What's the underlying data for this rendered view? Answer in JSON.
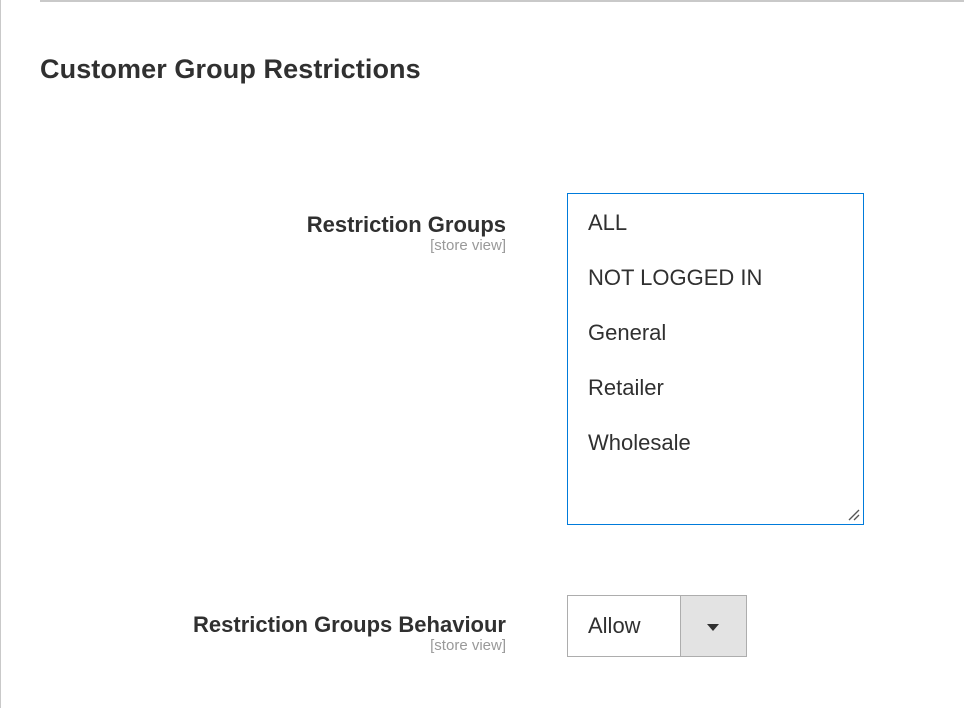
{
  "section": {
    "title": "Customer Group Restrictions"
  },
  "restriction_groups": {
    "label": "Restriction Groups",
    "scope": "[store view]",
    "options": [
      "ALL",
      "NOT LOGGED IN",
      "General",
      "Retailer",
      "Wholesale"
    ]
  },
  "restriction_groups_behaviour": {
    "label": "Restriction Groups Behaviour",
    "scope": "[store view]",
    "selected": "Allow"
  },
  "colors": {
    "focus_border": "#007bdb",
    "text": "#303030",
    "scope_text": "#999999",
    "select_button_bg": "#e3e3e3"
  },
  "icons": {
    "dropdown": "chevron-down-icon",
    "resize": "resize-handle-icon"
  }
}
